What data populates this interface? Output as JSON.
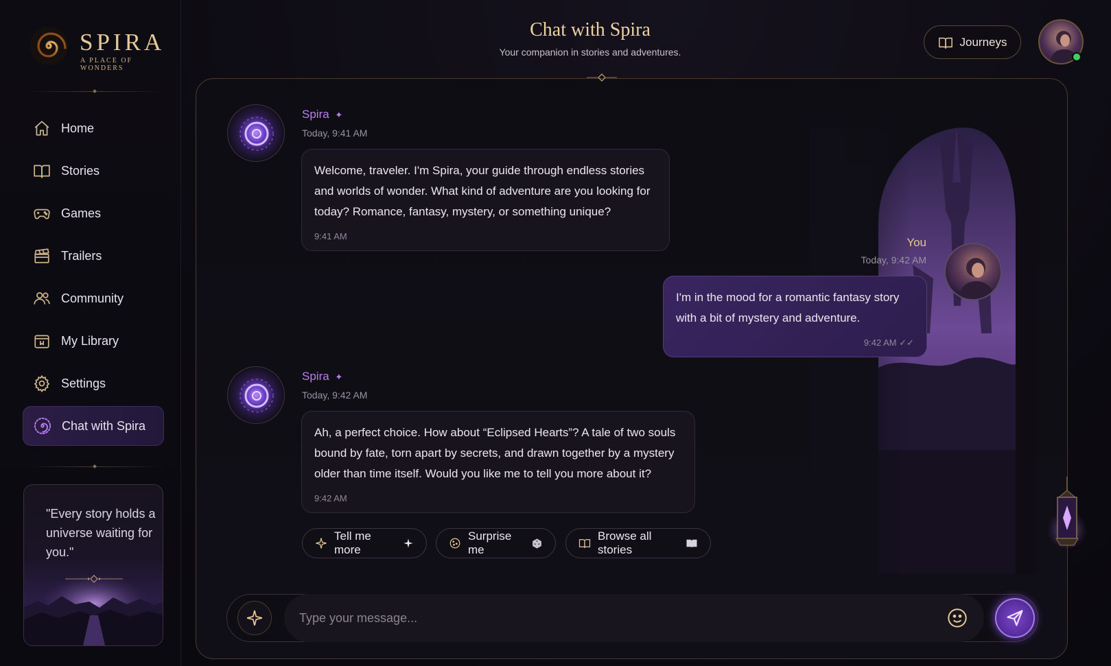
{
  "brand": {
    "name": "SPIRA",
    "tagline": "A PLACE OF WONDERS"
  },
  "header": {
    "title": "Chat with Spira",
    "subtitle": "Your companion in stories and adventures.",
    "journeys_label": "Journeys"
  },
  "sidebar": {
    "items": [
      {
        "label": "Home",
        "icon": "home-icon"
      },
      {
        "label": "Stories",
        "icon": "book-icon"
      },
      {
        "label": "Games",
        "icon": "gamepad-icon"
      },
      {
        "label": "Trailers",
        "icon": "clapperboard-icon"
      },
      {
        "label": "Community",
        "icon": "users-icon"
      },
      {
        "label": "My Library",
        "icon": "library-icon"
      },
      {
        "label": "Settings",
        "icon": "gear-icon"
      },
      {
        "label": "Chat with Spira",
        "icon": "spiral-icon",
        "active": true
      }
    ],
    "quote": "\"Every story holds a universe waiting for you.\""
  },
  "messages": [
    {
      "sender": "Spira",
      "timestamp": "Today, 9:41 AM",
      "text": "Welcome, traveler. I'm Spira, your guide through endless stories and worlds of wonder. What kind of adventure are you looking for today? Romance, fantasy, mystery, or something unique?",
      "time": "9:41 AM"
    },
    {
      "sender": "You",
      "timestamp": "Today, 9:42 AM",
      "text": "I'm in the mood for a romantic fantasy story with a bit of mystery and adventure.",
      "time": "9:42 AM"
    },
    {
      "sender": "Spira",
      "timestamp": "Today, 9:42 AM",
      "text": "Ah, a perfect choice. How about “Eclipsed Hearts”? A tale of two souls bound by fate, torn apart by secrets, and drawn together by a mystery older than time itself. Would you like me to tell you more about it?",
      "time": "9:42 AM"
    }
  ],
  "quick_replies": [
    {
      "label": "Tell me more"
    },
    {
      "label": "Surprise me"
    },
    {
      "label": "Browse all stories"
    }
  ],
  "composer": {
    "placeholder": "Type your message..."
  },
  "colors": {
    "accent_purple": "#b77ef0",
    "gold": "#e6c996",
    "online": "#3ecf5a"
  }
}
